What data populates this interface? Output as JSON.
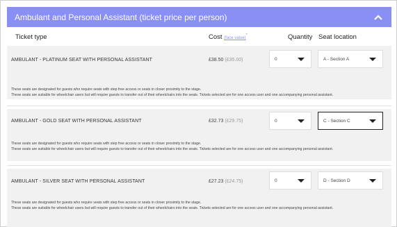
{
  "panel": {
    "title": "Ambulant and Personal Assistant (ticket price per person)"
  },
  "columns": {
    "ticket_type": "Ticket type",
    "cost": "Cost",
    "cost_note": "(face value)",
    "cost_sup": "*",
    "quantity": "Quantity",
    "seat_location": "Seat location"
  },
  "tickets": [
    {
      "name": "AMBULANT - PLATINUM SEAT WITH PERSONAL ASSISTANT",
      "price": "£38.50",
      "face_value": "(£35.00)",
      "quantity": "0",
      "seat": "A - Section A",
      "desc1": "These seats are designated for guests who require seats with step free access or seats in closer proximity to the stage.",
      "desc2": "These seats are suitable for wheelchair users but will require guests to transfer out of their wheelchairs into the seats. Tickets selected are for one access user and one accompanying personal assistant."
    },
    {
      "name": "AMBULANT - GOLD SEAT WITH PERSONAL ASSISTANT",
      "price": "£32.73",
      "face_value": "(£29.75)",
      "quantity": "0",
      "seat": "C - Section C",
      "desc1": "These seats are designated for guests who require seats with step free access or seats in closer proximity to the stage.",
      "desc2": "These seats are suitable for wheelchair users but will require guests to transfer out of their wheelchairs into the seats. Tickets selected are for one access user and one accompanying personal assistant."
    },
    {
      "name": "AMBULANT - SILVER SEAT WITH PERSONAL ASSISTANT",
      "price": "£27.23",
      "face_value": "(£24.75)",
      "quantity": "0",
      "seat": "D - Section D",
      "desc1": "These seats are designated for guests who require seats with step free access or seats in closer proximity to the stage.",
      "desc2": "These seats are suitable for wheelchair users but will require guests to transfer out of their wheelchairs into the seats. Tickets selected are for one access user and one accompanying personal assistant."
    }
  ],
  "colors": {
    "header_bg": "#8a8ff5",
    "row_bg": "#f1f1f1"
  },
  "icons": {
    "collapse": "chevron-up-icon",
    "dropdown": "caret-down-icon"
  }
}
